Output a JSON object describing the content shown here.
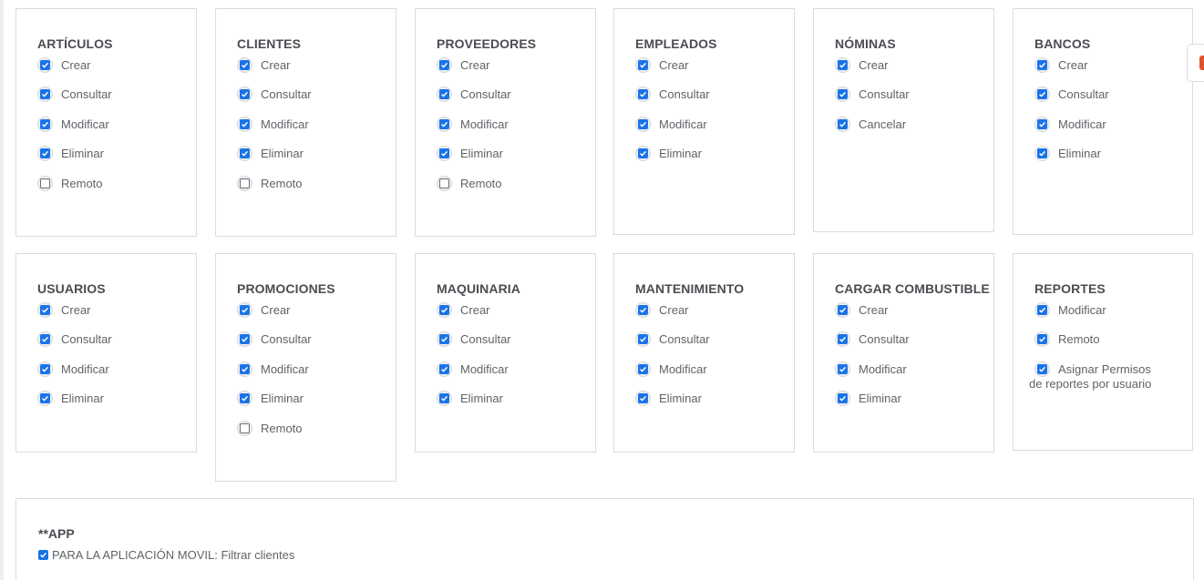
{
  "colors": {
    "checked": "#1a73e8",
    "border": "#d9dce0",
    "accent": "#e0522b"
  },
  "modules_row1": [
    {
      "title": "ARTÍCULOS",
      "perms": [
        {
          "label": "Crear",
          "checked": true
        },
        {
          "label": "Consultar",
          "checked": true
        },
        {
          "label": "Modificar",
          "checked": true
        },
        {
          "label": "Eliminar",
          "checked": true
        },
        {
          "label": "Remoto",
          "checked": false
        }
      ]
    },
    {
      "title": "CLIENTES",
      "perms": [
        {
          "label": "Crear",
          "checked": true
        },
        {
          "label": "Consultar",
          "checked": true
        },
        {
          "label": "Modificar",
          "checked": true
        },
        {
          "label": "Eliminar",
          "checked": true
        },
        {
          "label": "Remoto",
          "checked": false
        }
      ]
    },
    {
      "title": "PROVEEDORES",
      "perms": [
        {
          "label": "Crear",
          "checked": true
        },
        {
          "label": "Consultar",
          "checked": true
        },
        {
          "label": "Modificar",
          "checked": true
        },
        {
          "label": "Eliminar",
          "checked": true
        },
        {
          "label": "Remoto",
          "checked": false
        }
      ]
    },
    {
      "title": "EMPLEADOS",
      "perms": [
        {
          "label": "Crear",
          "checked": true
        },
        {
          "label": "Consultar",
          "checked": true
        },
        {
          "label": "Modificar",
          "checked": true
        },
        {
          "label": "Eliminar",
          "checked": true
        }
      ]
    },
    {
      "title": "NÓMINAS",
      "perms": [
        {
          "label": "Crear",
          "checked": true
        },
        {
          "label": "Consultar",
          "checked": true
        },
        {
          "label": "Cancelar",
          "checked": true
        }
      ]
    },
    {
      "title": "BANCOS",
      "perms": [
        {
          "label": "Crear",
          "checked": true
        },
        {
          "label": "Consultar",
          "checked": true
        },
        {
          "label": "Modificar",
          "checked": true
        },
        {
          "label": "Eliminar",
          "checked": true
        }
      ]
    }
  ],
  "modules_row2": [
    {
      "title": "USUARIOS",
      "perms": [
        {
          "label": "Crear",
          "checked": true
        },
        {
          "label": "Consultar",
          "checked": true
        },
        {
          "label": "Modificar",
          "checked": true
        },
        {
          "label": "Eliminar",
          "checked": true
        }
      ]
    },
    {
      "title": "PROMOCIONES",
      "perms": [
        {
          "label": "Crear",
          "checked": true
        },
        {
          "label": "Consultar",
          "checked": true
        },
        {
          "label": "Modificar",
          "checked": true
        },
        {
          "label": "Eliminar",
          "checked": true
        },
        {
          "label": "Remoto",
          "checked": false
        }
      ]
    },
    {
      "title": "MAQUINARIA",
      "perms": [
        {
          "label": "Crear",
          "checked": true
        },
        {
          "label": "Consultar",
          "checked": true
        },
        {
          "label": "Modificar",
          "checked": true
        },
        {
          "label": "Eliminar",
          "checked": true
        }
      ]
    },
    {
      "title": "MANTENIMIENTO",
      "perms": [
        {
          "label": "Crear",
          "checked": true
        },
        {
          "label": "Consultar",
          "checked": true
        },
        {
          "label": "Modificar",
          "checked": true
        },
        {
          "label": "Eliminar",
          "checked": true
        }
      ]
    },
    {
      "title": "CARGAR COMBUSTIBLE",
      "perms": [
        {
          "label": "Crear",
          "checked": true
        },
        {
          "label": "Consultar",
          "checked": true
        },
        {
          "label": "Modificar",
          "checked": true
        },
        {
          "label": "Eliminar",
          "checked": true
        }
      ]
    },
    {
      "title": "REPORTES",
      "perms": [
        {
          "label": "Modificar",
          "checked": true
        },
        {
          "label": "Remoto",
          "checked": true
        },
        {
          "label": "Asignar Permisos de reportes por usuario",
          "checked": true
        }
      ]
    }
  ],
  "app": {
    "title": "**APP",
    "option_label": "PARA LA APLICACIÓN MOVIL: Filtrar clientes",
    "option_checked": true
  }
}
